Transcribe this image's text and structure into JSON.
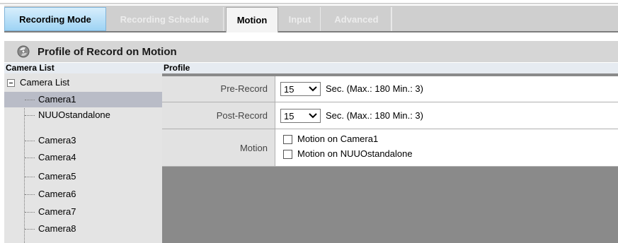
{
  "tabs": [
    {
      "label": "Recording Mode",
      "state": "accent"
    },
    {
      "label": "Recording Schedule",
      "state": "dim"
    },
    {
      "label": "Motion",
      "state": "active"
    },
    {
      "label": "Input",
      "state": "dim"
    },
    {
      "label": "Advanced",
      "state": "dim"
    }
  ],
  "section": {
    "title": "Profile of Record on Motion",
    "icon": "record-disc-icon"
  },
  "columns": {
    "left": "Camera List",
    "right": "Profile"
  },
  "tree": {
    "root": "Camera List",
    "items": [
      "Camera1",
      "NUUOstandalone",
      "Camera3",
      "Camera4",
      "Camera5",
      "Camera6",
      "Camera7",
      "Camera8"
    ],
    "selected": "Camera1"
  },
  "profile": {
    "pre_record": {
      "label": "Pre-Record",
      "value": "15",
      "note": "Sec. (Max.: 180 Min.: 3)"
    },
    "post_record": {
      "label": "Post-Record",
      "value": "15",
      "note": "Sec. (Max.: 180 Min.: 3)"
    },
    "motion": {
      "label": "Motion",
      "options": [
        "Motion on Camera1",
        "Motion on NUUOstandalone"
      ]
    }
  },
  "colors": {
    "accent_tab": "#9ed3f4",
    "selected_row": "#b9bcc7",
    "panel_gray": "#8a8a8a"
  }
}
